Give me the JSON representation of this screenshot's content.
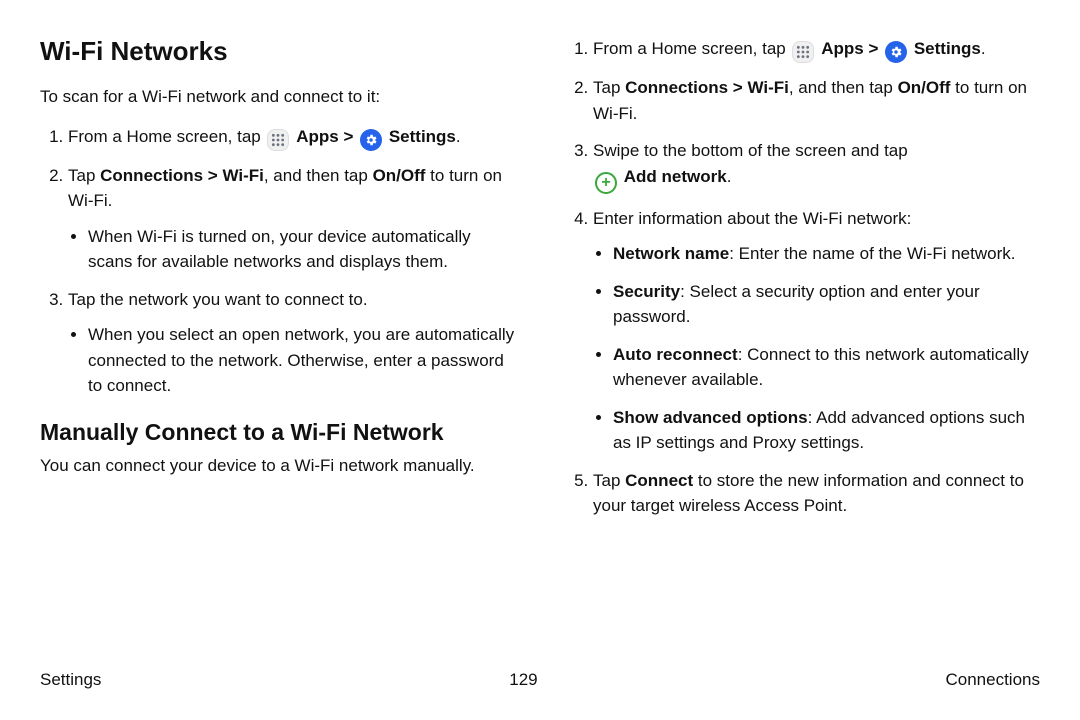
{
  "left": {
    "heading1": "Wi-Fi Networks",
    "intro1": "To scan for a Wi-Fi network and connect to it:",
    "step1_pre": "From a Home screen, tap ",
    "apps_label": "Apps",
    "sep": " > ",
    "settings_label": "Settings",
    "period": ".",
    "step2_pre": "Tap ",
    "step2_bold": "Connections > Wi-Fi",
    "step2_mid": ", and then tap ",
    "step2_bold2": "On/Off",
    "step2_post": " to turn on Wi-Fi.",
    "step2_bullet": "When Wi-Fi is turned on, your device automatically scans for available networks and displays them.",
    "step3": "Tap the network you want to connect to.",
    "step3_bullet": "When you select an open network, you are automatically connected to the network. Otherwise, enter a password to connect.",
    "heading2": "Manually Connect to a Wi-Fi Network",
    "intro2": "You can connect your device to a Wi-Fi network manually."
  },
  "right": {
    "step1_pre": "From a Home screen, tap ",
    "apps_label": "Apps",
    "sep": " > ",
    "settings_label": "Settings",
    "period": ".",
    "step2_pre": "Tap ",
    "step2_bold": "Connections > Wi-Fi",
    "step2_mid": ", and then tap ",
    "step2_bold2": "On/Off",
    "step2_post": " to turn on Wi-Fi.",
    "step3": "Swipe to the bottom of the screen and tap ",
    "step3_add": "Add network",
    "step4": "Enter information about the Wi-Fi network:",
    "b1_bold": "Network name",
    "b1_text": ": Enter the name of the Wi-Fi network.",
    "b2_bold": "Security",
    "b2_text": ": Select a security option and enter your password.",
    "b3_bold": "Auto reconnect",
    "b3_text": ": Connect to this network automatically whenever available.",
    "b4_bold": "Show advanced options",
    "b4_text": ": Add advanced options such as IP settings and Proxy settings.",
    "step5_pre": "Tap ",
    "step5_bold": "Connect",
    "step5_post": " to store the new information and connect to your target wireless Access Point."
  },
  "footer": {
    "left": "Settings",
    "center": "129",
    "right": "Connections"
  }
}
